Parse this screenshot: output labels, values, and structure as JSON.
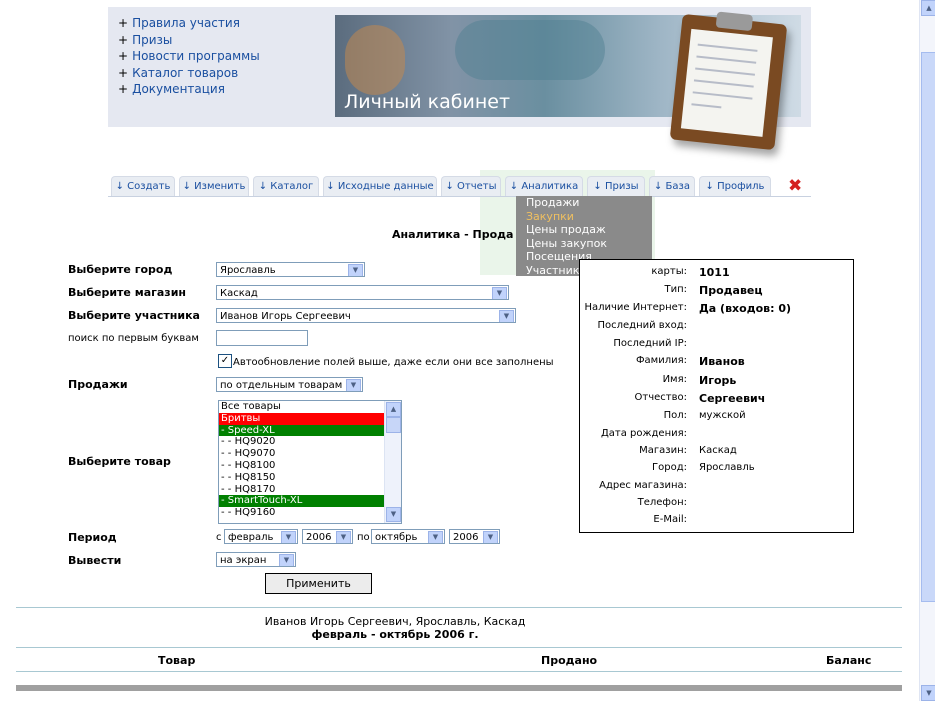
{
  "nav_links": [
    "Правила участия",
    "Призы",
    "Новости программы",
    "Каталог товаров",
    "Документация"
  ],
  "nav_bullet": "+",
  "banner_title": "Личный кабинет",
  "tabs": [
    "↓ Создать",
    "↓ Изменить",
    "↓ Каталог",
    "↓ Исходные данные",
    "↓ Отчеты",
    "↓ Аналитика",
    "↓ Призы",
    "↓ База",
    "↓ Профиль"
  ],
  "close_icon": "✖",
  "analytics_menu": [
    "Продажи",
    "Закупки",
    "Цены продаж",
    "Цены закупок",
    "Посещения",
    "Участники"
  ],
  "page_heading": "Аналитика - Прода",
  "form": {
    "city_label": "Выберите город",
    "city_value": "Ярославль",
    "store_label": "Выберите магазин",
    "store_value": "Каскад",
    "participant_label": "Выберите участника",
    "participant_value": "Иванов Игорь Сергеевич",
    "search_label": "поиск по первым буквам",
    "search_value": "",
    "autoupdate_checked": "✓",
    "autoupdate_label": "Автообновление полей выше, даже если они все заполнены",
    "sales_label": "Продажи",
    "sales_value": "по отдельным товарам",
    "product_label": "Выберите товар",
    "products": [
      "Все товары",
      "Бритвы",
      "- Speed-XL",
      "- - HQ9020",
      "- - HQ9070",
      "- - HQ8100",
      "- - HQ8150",
      "- - HQ8170",
      "- SmartTouch-XL",
      "- - HQ9160"
    ],
    "period_label": "Период",
    "period_from_word": "с",
    "period_from_month": "февраль",
    "period_from_year": "2006",
    "period_to_word": "по",
    "period_to_month": "октябрь",
    "period_to_year": "2006",
    "output_label": "Вывести",
    "output_value": "на экран",
    "apply_label": "Применить"
  },
  "info": [
    {
      "key": "карты:",
      "value": "1011",
      "bold": true
    },
    {
      "key": "Тип:",
      "value": "Продавец",
      "bold": true
    },
    {
      "key": "Наличие Интернет:",
      "value": "Да (входов: 0)",
      "bold": true
    },
    {
      "key": "Последний вход:",
      "value": "",
      "bold": false
    },
    {
      "key": "Последний IP:",
      "value": "",
      "bold": false
    },
    {
      "key": "Фамилия:",
      "value": "Иванов",
      "bold": true
    },
    {
      "key": "Имя:",
      "value": "Игорь",
      "bold": true
    },
    {
      "key": "Отчество:",
      "value": "Сергеевич",
      "bold": true
    },
    {
      "key": "Пол:",
      "value": "мужской",
      "bold": false
    },
    {
      "key": "Дата рождения:",
      "value": "",
      "bold": false
    },
    {
      "key": "Магазин:",
      "value": "Каскад",
      "bold": false
    },
    {
      "key": "Город:",
      "value": "Ярославль",
      "bold": false
    },
    {
      "key": "Адрес магазина:",
      "value": "",
      "bold": false
    },
    {
      "key": "Телефон:",
      "value": "",
      "bold": false
    },
    {
      "key": "E-Mail:",
      "value": "",
      "bold": false
    }
  ],
  "report": {
    "title_line1": "Иванов Игорь Сергеевич, Ярославль, Каскад",
    "title_line2": "февраль - октябрь 2006 г.",
    "col_product": "Товар",
    "col_sold": "Продано",
    "col_balance": "Баланс"
  },
  "colors": {
    "link": "#1a4fa0",
    "menu_bg": "#8a8a8a",
    "menu_active": "#f0c060",
    "list_red": "#ff0000",
    "list_green": "#008000"
  }
}
